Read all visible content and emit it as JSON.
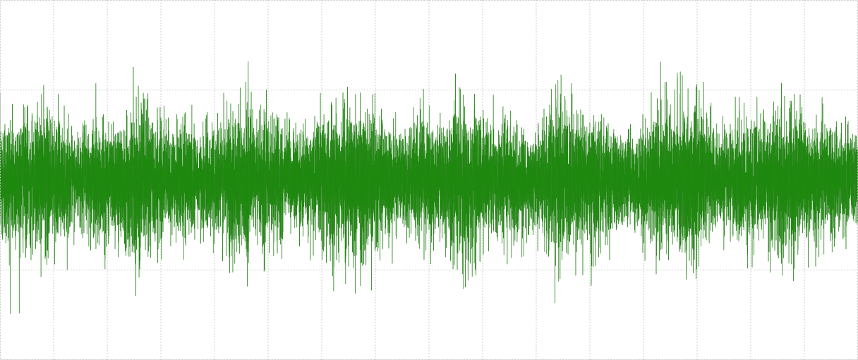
{
  "chart_data": {
    "type": "line",
    "title": "",
    "xlabel": "",
    "ylabel": "",
    "grid": true,
    "grid_style": "dotted",
    "legend": "none",
    "series": [
      {
        "color": "#1f8a0f",
        "dark_color": "#0f4f08",
        "sample_count": 16000,
        "description_envelope": {
          "center": 0.0,
          "typical_amplitude": 0.9,
          "peak_high": 1.33,
          "peak_low": -1.68
        }
      }
    ],
    "xlim": [
      0,
      16
    ],
    "ylim": [
      -2,
      2
    ],
    "x_grid_count": 16,
    "y_grid_values": [
      -2,
      -1,
      0,
      1,
      2
    ]
  }
}
